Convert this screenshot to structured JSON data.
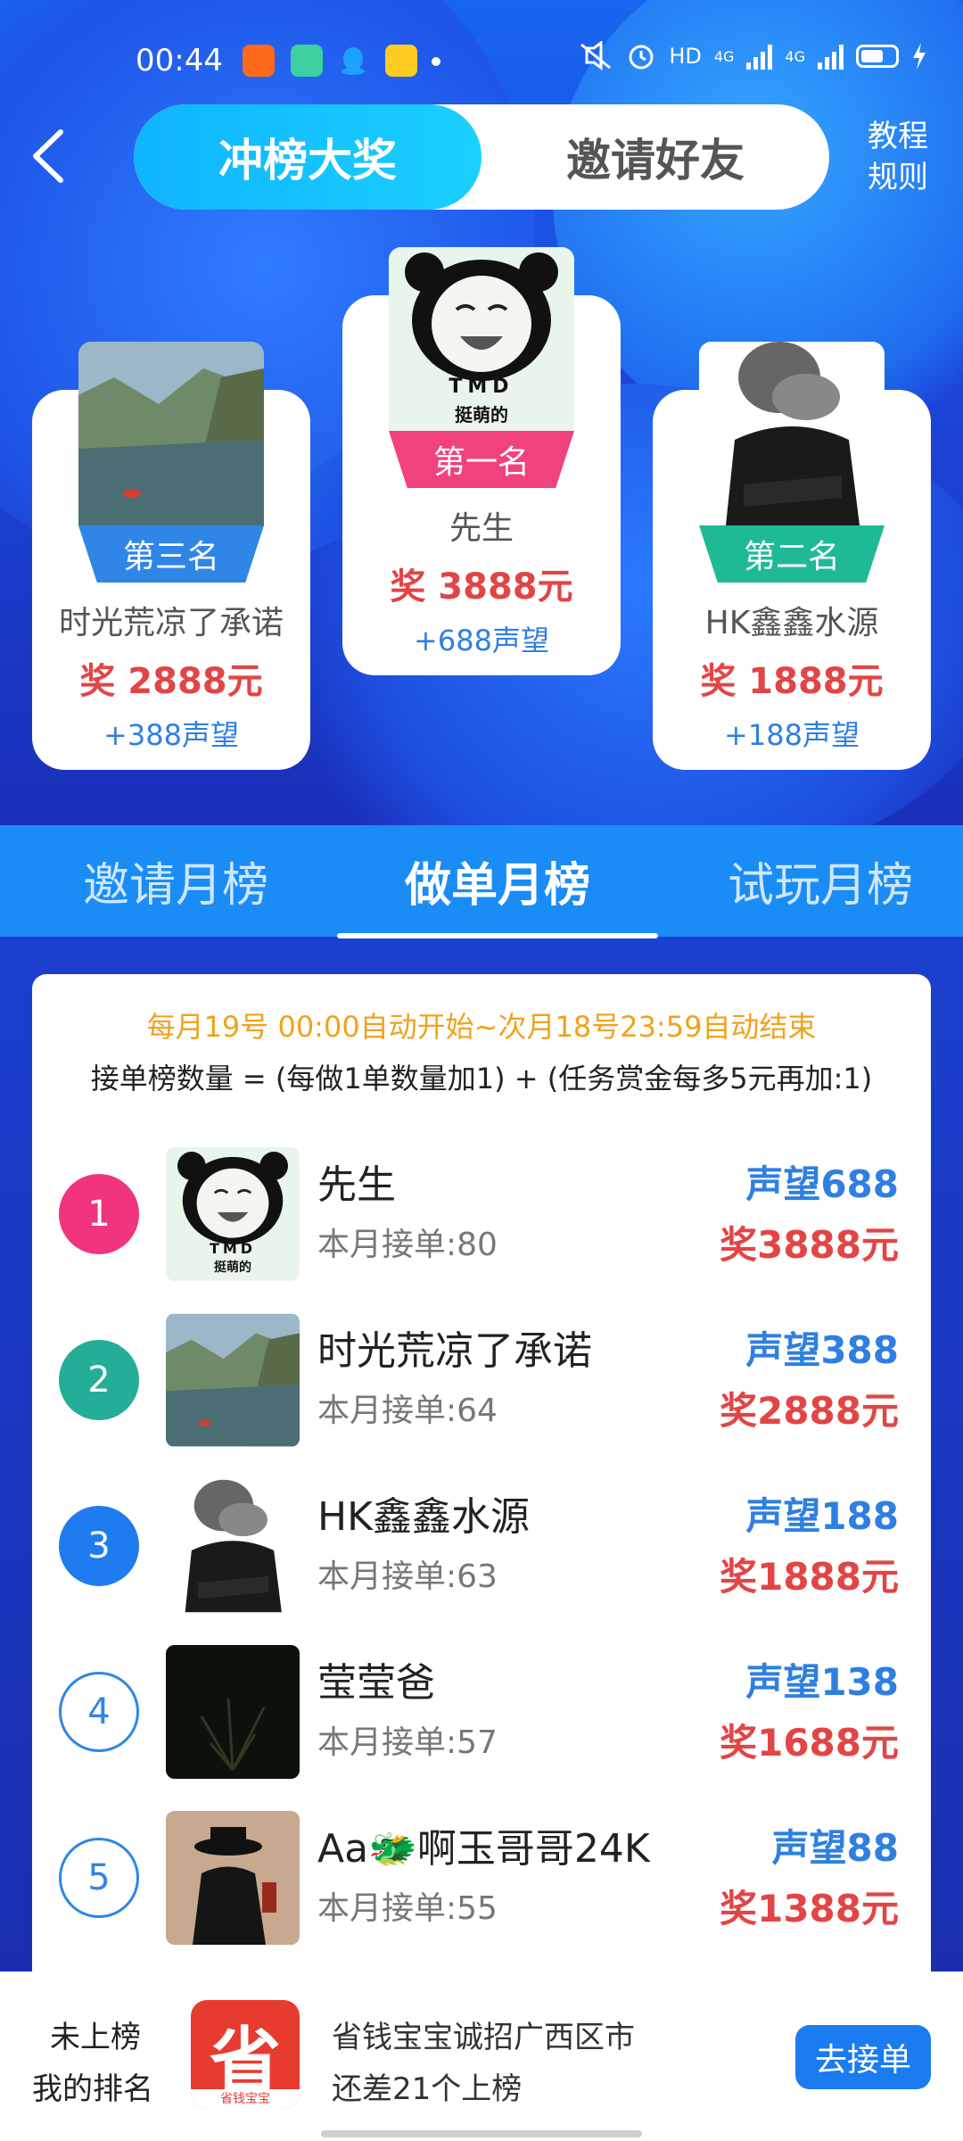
{
  "status_bar": {
    "time": "00:44",
    "hd_label": "HD",
    "network_1": "4G",
    "network_2": "4G"
  },
  "header": {
    "tab_active": "冲榜大奖",
    "tab_inactive": "邀请好友",
    "link_tutorial": "教程",
    "link_rules": "规则"
  },
  "podium": [
    {
      "rank_label": "第一名",
      "name": "先生",
      "prize": "奖 3888元",
      "fame": "+688声望",
      "rank_color": "#f1427c",
      "avatar": "panda-meme",
      "avatar_text_1": "TMD",
      "avatar_text_2": "挺萌的"
    },
    {
      "rank_label": "第二名",
      "name": "HK鑫鑫水源",
      "prize": "奖 1888元",
      "fame": "+188声望",
      "rank_color": "#1fb996",
      "avatar": "smoke-man"
    },
    {
      "rank_label": "第三名",
      "name": "时光荒凉了承诺",
      "prize": "奖 2888元",
      "fame": "+388声望",
      "rank_color": "#2f86e6",
      "avatar": "river-landscape"
    }
  ],
  "board_tabs": [
    "邀请月榜",
    "做单月榜",
    "试玩月榜"
  ],
  "rules": {
    "line1": "每月19号 00:00自动开始~次月18号23:59自动结束",
    "line2": "接单榜数量 = (每做1单数量加1) + (任务赏金每多5元再加:1)"
  },
  "ranking": [
    {
      "rank": "1",
      "name": "先生",
      "count": "本月接单:80",
      "fame": "声望688",
      "prize": "奖3888元",
      "color": "#f0347d",
      "avatar": "panda-meme"
    },
    {
      "rank": "2",
      "name": "时光荒凉了承诺",
      "count": "本月接单:64",
      "fame": "声望388",
      "prize": "奖2888元",
      "color": "#24ad97",
      "avatar": "river-landscape"
    },
    {
      "rank": "3",
      "name": "HK鑫鑫水源",
      "count": "本月接单:63",
      "fame": "声望188",
      "prize": "奖1888元",
      "color": "#1f7bf0",
      "avatar": "smoke-man"
    },
    {
      "rank": "4",
      "name": "莹莹爸",
      "count": "本月接单:57",
      "fame": "声望138",
      "prize": "奖1688元",
      "color": "outline",
      "avatar": "dark-plant"
    },
    {
      "rank": "5",
      "name": "Aa🐲啊玉哥哥24K",
      "count": "本月接单:55",
      "fame": "声望88",
      "prize": "奖1388元",
      "color": "outline",
      "avatar": "man-in-hat"
    }
  ],
  "bottom_bar": {
    "status": "未上榜",
    "label": "我的排名",
    "logo_char": "省",
    "logo_caption": "省钱宝宝",
    "line1": "省钱宝宝诚招广西区市",
    "line2": "还差21个上榜",
    "button": "去接单"
  }
}
